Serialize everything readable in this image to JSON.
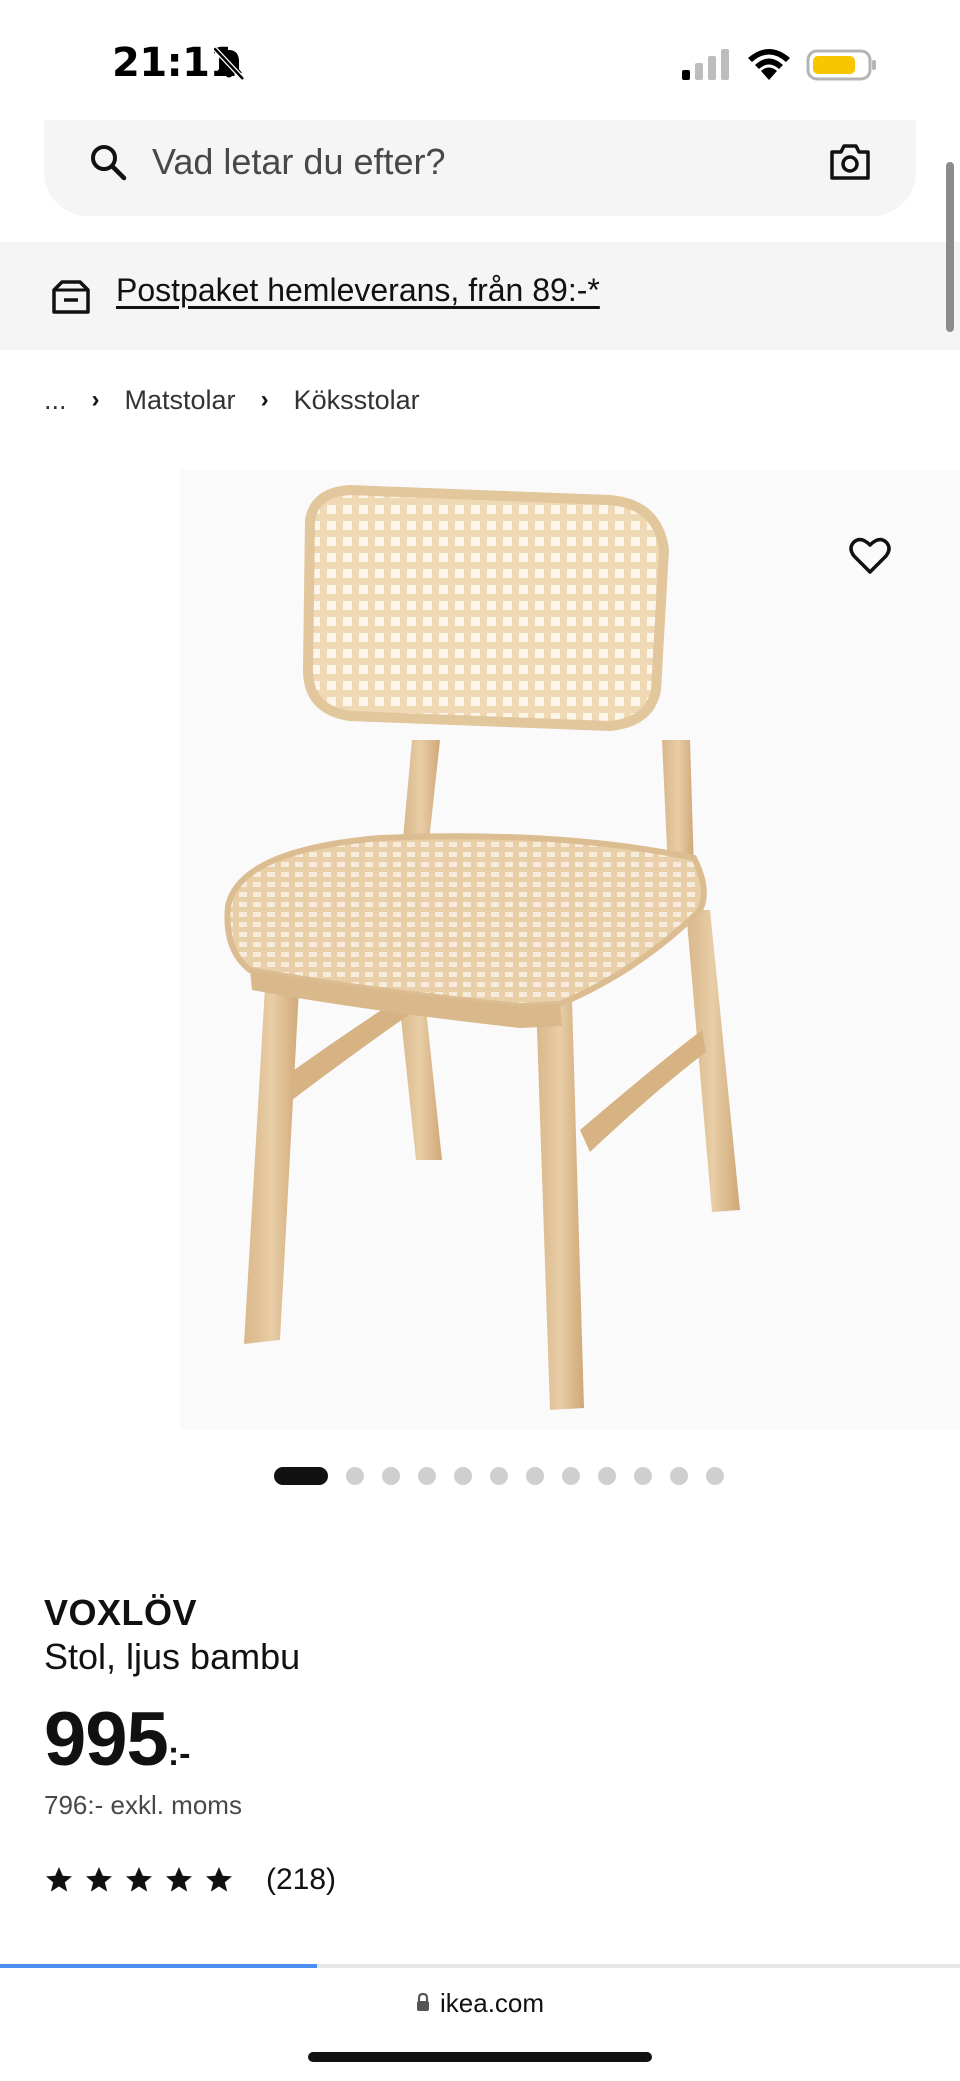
{
  "status_bar": {
    "time": "21:11",
    "battery_color": "#f7c600"
  },
  "search": {
    "placeholder": "Vad letar du efter?"
  },
  "delivery_banner": {
    "text": "Postpaket hemleverans, från 89:-*"
  },
  "breadcrumb": {
    "items": [
      "...",
      "Matstolar",
      "Köksstolar"
    ]
  },
  "carousel": {
    "total_dots": 12,
    "active_index": 0
  },
  "product": {
    "brand": "VOXLÖV",
    "description": "Stol, ljus bambu",
    "price": "995",
    "price_suffix": ":-",
    "price_excl": "796:- exkl. moms",
    "rating_stars": 5,
    "rating_count": "(218)"
  },
  "browser": {
    "url": "ikea.com",
    "load_progress": 0.33,
    "progress_color": "#4a8ff0"
  },
  "icons": {
    "search": "search-icon",
    "camera": "camera-icon",
    "delivery": "truck-icon",
    "favorite": "heart-icon",
    "star": "star-icon",
    "lock": "lock-icon"
  }
}
